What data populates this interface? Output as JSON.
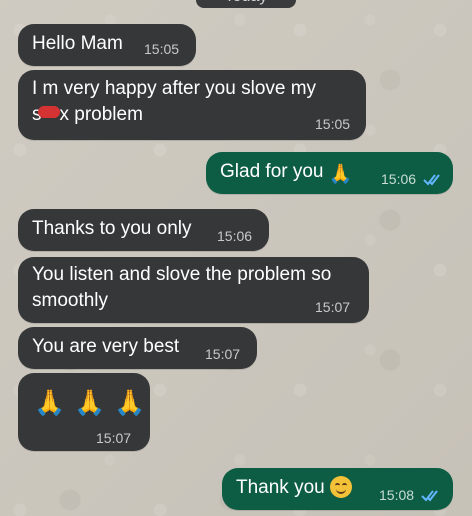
{
  "chat": {
    "date_label": "Today",
    "messages": [
      {
        "direction": "incoming",
        "text": "Hello Mam",
        "time": "15:05"
      },
      {
        "direction": "incoming",
        "text_line1": "I m very happy after you slove my",
        "text_line2_prefix": "s",
        "text_line2_suffix": "x problem",
        "time": "15:05"
      },
      {
        "direction": "outgoing",
        "text": "Glad for you",
        "emoji": "🙏",
        "time": "15:06"
      },
      {
        "direction": "incoming",
        "text": "Thanks to you only",
        "time": "15:06"
      },
      {
        "direction": "incoming",
        "text_line1": "You listen and slove the problem so",
        "text_line2": "smoothly",
        "time": "15:07"
      },
      {
        "direction": "incoming",
        "text": "You are very best",
        "time": "15:07"
      },
      {
        "direction": "incoming",
        "emojis": [
          "🙏",
          "🙏",
          "🙏"
        ],
        "time": "15:07"
      },
      {
        "direction": "outgoing",
        "text": "Thank you",
        "time": "15:08"
      }
    ]
  },
  "icons": {
    "read_ticks": "double-check-icon",
    "pray": "folded-hands-icon",
    "smile": "smiling-face-icon"
  },
  "colors": {
    "incoming_bubble": "#363739",
    "outgoing_bubble": "#0d5d44",
    "read_tick": "#62b6ff",
    "wallpaper": "#cdc8be"
  }
}
